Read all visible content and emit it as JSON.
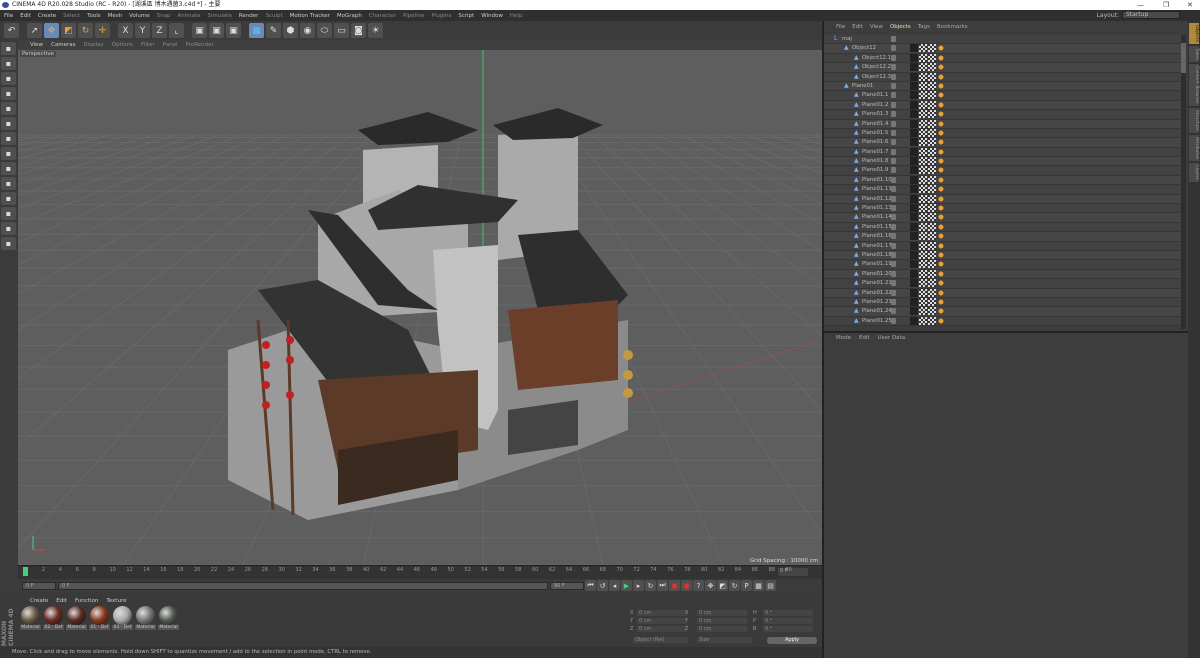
{
  "window": {
    "title": "CINEMA 4D R20.028 Studio (RC - R20) - [湖溪區 博木遇菌3.c4d *] - 主要",
    "controls": [
      "—",
      "❐",
      "✕"
    ]
  },
  "menu": [
    "File",
    "Edit",
    "Create",
    "Select",
    "Tools",
    "Mesh",
    "Volume",
    "Snap",
    "Animate",
    "Simulate",
    "Render",
    "Sculpt",
    "Motion Tracker",
    "MoGraph",
    "Character",
    "Pipeline",
    "Plugins",
    "Script",
    "Window",
    "Help"
  ],
  "layout": {
    "label": "Layout:",
    "value": "Startup"
  },
  "toolbar": {
    "icons": [
      "undo-icon",
      "live-selection-icon",
      "move-icon",
      "scale-icon",
      "rotate-icon",
      "move-axis-icon",
      "x-axis-icon",
      "y-axis-icon",
      "z-axis-icon",
      "coordinate-system-icon",
      "render-view-icon",
      "render-picture-viewer-icon",
      "render-settings-icon",
      "cube-icon",
      "pen-icon",
      "subdivision-icon",
      "array-icon",
      "deformer-icon",
      "floor-icon",
      "camera-icon",
      "light-icon"
    ],
    "labels": {
      "x": "X",
      "y": "Y",
      "z": "Z"
    }
  },
  "viewport": {
    "menu": [
      "View",
      "Cameras",
      "Display",
      "Options",
      "Filter",
      "Panel",
      "ProRender"
    ],
    "active": "Cameras",
    "camera_label": "Perspective",
    "grid_spacing": "Grid Spacing : 10000 cm",
    "accent": "#3fd47a"
  },
  "timeline": {
    "ticks": [
      "0",
      "2",
      "4",
      "6",
      "8",
      "10",
      "12",
      "14",
      "16",
      "18",
      "20",
      "22",
      "24",
      "26",
      "28",
      "30",
      "32",
      "34",
      "36",
      "38",
      "40",
      "42",
      "44",
      "46",
      "48",
      "50",
      "52",
      "54",
      "56",
      "58",
      "60",
      "62",
      "64",
      "66",
      "68",
      "70",
      "72",
      "74",
      "76",
      "78",
      "80",
      "82",
      "84",
      "86",
      "88",
      "90"
    ],
    "current": "0 F",
    "start": "0 F",
    "start_small": "0 F",
    "end": "90 F",
    "end_field": "90 F"
  },
  "materials": {
    "menu": [
      "Create",
      "Edit",
      "Function",
      "Texture"
    ],
    "items": [
      {
        "label": "Material",
        "color": "#6b5a45"
      },
      {
        "label": "02 - Def",
        "color": "#6a2a1e"
      },
      {
        "label": "Material",
        "color": "#5a2a22"
      },
      {
        "label": "01 - Def",
        "color": "#8a3a1a"
      },
      {
        "label": "03 - Def",
        "color": "#aaaaaa"
      },
      {
        "label": "Material",
        "color": "#777"
      },
      {
        "label": "Material",
        "color": "#555a50"
      }
    ]
  },
  "brand": "MAXON CINEMA 4D",
  "coords": {
    "rows": [
      {
        "a": "X",
        "av": "0 cm",
        "b": "X",
        "bv": "0 cm",
        "c": "H",
        "cv": "0 °"
      },
      {
        "a": "Y",
        "av": "0 cm",
        "b": "Y",
        "bv": "0 cm",
        "c": "P",
        "cv": "0 °"
      },
      {
        "a": "Z",
        "av": "0 cm",
        "b": "Z",
        "bv": "0 cm",
        "c": "B",
        "cv": "0 °"
      }
    ],
    "mode1": "Object (Rel)",
    "mode2": "Size",
    "apply": "Apply"
  },
  "status": "Move: Click and drag to move elements. Hold down SHIFT to quantize movement / add to the selection in point mode, CTRL to remove.",
  "object_manager": {
    "menu": [
      "File",
      "Edit",
      "View",
      "Objects",
      "Tags",
      "Bookmarks"
    ],
    "active": "Objects",
    "rows": [
      {
        "name": "maj",
        "level": 0
      },
      {
        "name": "Object12",
        "level": 1
      },
      {
        "name": "Object12.1",
        "level": 2
      },
      {
        "name": "Object12.2",
        "level": 2
      },
      {
        "name": "Object12.3",
        "level": 2
      },
      {
        "name": "Plane01",
        "level": 1
      },
      {
        "name": "Plane01.1",
        "level": 2
      },
      {
        "name": "Plane01.2",
        "level": 2
      },
      {
        "name": "Plane01.3",
        "level": 2
      },
      {
        "name": "Plane01.4",
        "level": 2
      },
      {
        "name": "Plane01.5",
        "level": 2
      },
      {
        "name": "Plane01.6",
        "level": 2
      },
      {
        "name": "Plane01.7",
        "level": 2
      },
      {
        "name": "Plane01.8",
        "level": 2
      },
      {
        "name": "Plane01.9",
        "level": 2
      },
      {
        "name": "Plane01.10",
        "level": 2
      },
      {
        "name": "Plane01.11",
        "level": 2
      },
      {
        "name": "Plane01.12",
        "level": 2
      },
      {
        "name": "Plane01.13",
        "level": 2
      },
      {
        "name": "Plane01.14",
        "level": 2
      },
      {
        "name": "Plane01.15",
        "level": 2
      },
      {
        "name": "Plane01.16",
        "level": 2
      },
      {
        "name": "Plane01.17",
        "level": 2
      },
      {
        "name": "Plane01.18",
        "level": 2
      },
      {
        "name": "Plane01.19",
        "level": 2
      },
      {
        "name": "Plane01.20",
        "level": 2
      },
      {
        "name": "Plane01.21",
        "level": 2
      },
      {
        "name": "Plane01.22",
        "level": 2
      },
      {
        "name": "Plane01.23",
        "level": 2
      },
      {
        "name": "Plane01.24",
        "level": 2
      },
      {
        "name": "Plane01.25",
        "level": 2
      }
    ]
  },
  "attributes": {
    "menu": [
      "Mode",
      "Edit",
      "User Data"
    ]
  },
  "right_tabs": [
    "Objects",
    "Takes",
    "Content Browser",
    "Structure",
    "Attributes",
    "Layers"
  ]
}
